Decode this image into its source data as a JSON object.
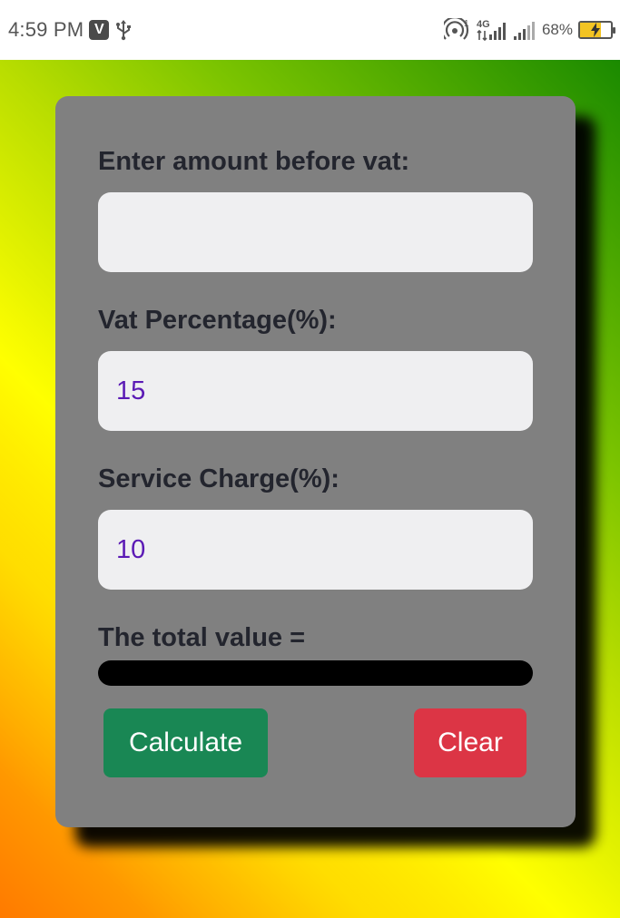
{
  "status_bar": {
    "time": "4:59 PM",
    "v_badge": "V",
    "network_type": "4G",
    "hotspot_count": "1",
    "battery_percent": "68%",
    "battery_level": 0.68,
    "icons": [
      "v-app-icon",
      "usb-icon",
      "hotspot-icon",
      "signal-4g-icon",
      "signal-icon",
      "battery-charging-icon"
    ]
  },
  "form": {
    "amount_label": "Enter amount before vat:",
    "amount_value": "",
    "vat_label": "Vat Percentage(%):",
    "vat_value": "15",
    "service_label": "Service Charge(%):",
    "service_value": "10",
    "total_label": "The total value =",
    "total_value": ""
  },
  "buttons": {
    "calculate": "Calculate",
    "clear": "Clear"
  },
  "colors": {
    "card": "#808080",
    "input_bg": "#efeff1",
    "input_text": "#5b1ab5",
    "label_text": "#23252e",
    "calculate_bg": "#198754",
    "clear_bg": "#dc3545",
    "total_bar": "#000000"
  }
}
